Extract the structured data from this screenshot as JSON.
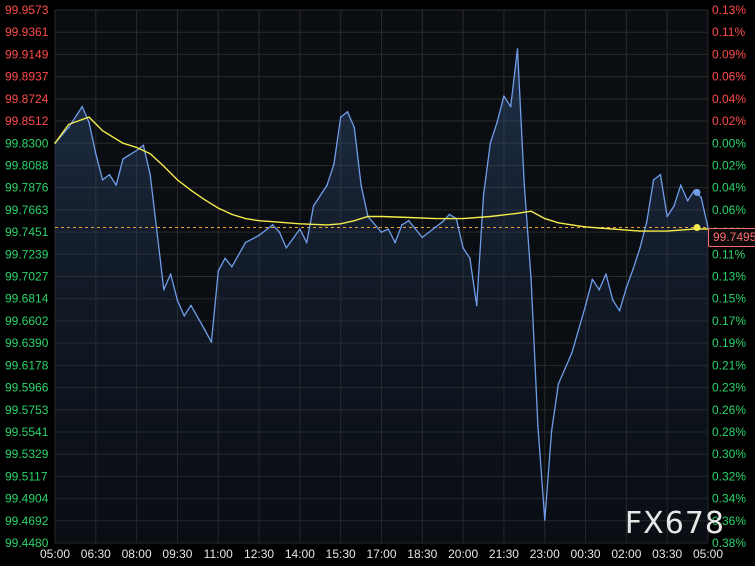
{
  "watermark": "FX678",
  "last_price_label": "99.7495",
  "colors": {
    "background": "#000000",
    "grid": "#2a2a2a",
    "price_line": "#6f9de8",
    "average_line": "#f4ec4a",
    "baseline": "#f2a232",
    "up_text": "#ff4b4b",
    "down_text": "#2bd46b",
    "x_text": "#e6e6e6"
  },
  "chart_data": {
    "type": "line",
    "title": "",
    "xlabel": "",
    "ylabel": "",
    "grid": true,
    "x_ticks": [
      "05:00",
      "06:30",
      "08:00",
      "09:30",
      "11:00",
      "12:30",
      "14:00",
      "15:30",
      "17:00",
      "18:30",
      "20:00",
      "21:30",
      "23:00",
      "00:30",
      "02:00",
      "03:30",
      "05:00"
    ],
    "y_ticks_left": [
      "99.9573",
      "99.9361",
      "99.9149",
      "99.8937",
      "99.8724",
      "99.8512",
      "99.8300",
      "99.8088",
      "99.7876",
      "99.7663",
      "99.7451",
      "99.7239",
      "99.7027",
      "99.6814",
      "99.6602",
      "99.6390",
      "99.6178",
      "99.5966",
      "99.5753",
      "99.5541",
      "99.5329",
      "99.5117",
      "99.4904",
      "99.4692",
      "99.4480"
    ],
    "y_ticks_right": [
      "0.13%",
      "0.11%",
      "0.09%",
      "0.06%",
      "0.04%",
      "0.02%",
      "0.00%",
      "0.02%",
      "0.04%",
      "0.06%",
      "0.09%",
      "0.11%",
      "0.13%",
      "0.15%",
      "0.17%",
      "0.19%",
      "0.21%",
      "0.23%",
      "0.26%",
      "0.28%",
      "0.30%",
      "0.32%",
      "0.34%",
      "0.36%",
      "0.38%"
    ],
    "ylim": [
      99.448,
      99.9573
    ],
    "baseline": 99.83,
    "last_value": 99.7495,
    "series": [
      {
        "role": "price",
        "x": [
          "05:00",
          "05:30",
          "06:00",
          "06:15",
          "06:30",
          "06:45",
          "07:00",
          "07:15",
          "07:30",
          "08:00",
          "08:15",
          "08:30",
          "09:00",
          "09:15",
          "09:30",
          "09:45",
          "10:00",
          "10:30",
          "10:45",
          "11:00",
          "11:15",
          "11:30",
          "12:00",
          "12:30",
          "13:00",
          "13:15",
          "13:30",
          "14:00",
          "14:15",
          "14:30",
          "15:00",
          "15:15",
          "15:30",
          "15:45",
          "16:00",
          "16:15",
          "16:30",
          "17:00",
          "17:15",
          "17:30",
          "17:45",
          "18:00",
          "18:30",
          "19:00",
          "19:15",
          "19:30",
          "19:45",
          "20:00",
          "20:15",
          "20:30",
          "20:45",
          "21:00",
          "21:15",
          "21:30",
          "21:45",
          "22:00",
          "22:15",
          "22:30",
          "22:45",
          "23:00",
          "23:15",
          "23:30",
          "23:45",
          "00:00",
          "00:30",
          "00:45",
          "01:00",
          "01:15",
          "01:30",
          "01:45",
          "02:00",
          "02:15",
          "02:30",
          "02:45",
          "03:00",
          "03:15",
          "03:30",
          "03:45",
          "04:00",
          "04:15",
          "04:30",
          "04:45",
          "05:00"
        ],
        "values": [
          99.83,
          99.845,
          99.865,
          99.85,
          99.82,
          99.795,
          99.8,
          99.79,
          99.815,
          99.823,
          99.828,
          99.8,
          99.69,
          99.705,
          99.68,
          99.665,
          99.675,
          99.652,
          99.64,
          99.708,
          99.72,
          99.712,
          99.735,
          99.742,
          99.752,
          99.745,
          99.73,
          99.748,
          99.735,
          99.77,
          99.79,
          99.81,
          99.855,
          99.86,
          99.845,
          99.79,
          99.76,
          99.745,
          99.748,
          99.735,
          99.752,
          99.756,
          99.74,
          99.75,
          99.755,
          99.762,
          99.758,
          99.73,
          99.72,
          99.675,
          99.78,
          99.83,
          99.85,
          99.875,
          99.865,
          99.92,
          99.79,
          99.7,
          99.56,
          99.47,
          99.555,
          99.6,
          99.615,
          99.63,
          99.675,
          99.7,
          99.69,
          99.705,
          99.68,
          99.67,
          99.692,
          99.71,
          99.73,
          99.755,
          99.795,
          99.8,
          99.76,
          99.77,
          99.79,
          99.775,
          99.785,
          99.778,
          99.7495
        ]
      },
      {
        "role": "average",
        "x": [
          "05:00",
          "05:30",
          "06:15",
          "06:45",
          "07:30",
          "08:00",
          "08:30",
          "09:00",
          "09:30",
          "10:00",
          "10:30",
          "11:00",
          "11:30",
          "12:00",
          "12:30",
          "13:00",
          "14:00",
          "15:00",
          "15:30",
          "16:00",
          "16:30",
          "17:00",
          "18:00",
          "19:00",
          "20:00",
          "21:00",
          "22:00",
          "22:30",
          "23:00",
          "23:30",
          "00:00",
          "00:30",
          "01:00",
          "01:30",
          "02:00",
          "02:30",
          "03:00",
          "03:30",
          "04:00",
          "04:30",
          "05:00"
        ],
        "values": [
          99.83,
          99.848,
          99.855,
          99.842,
          99.83,
          99.826,
          99.82,
          99.808,
          99.795,
          99.785,
          99.776,
          99.768,
          99.762,
          99.758,
          99.756,
          99.755,
          99.753,
          99.752,
          99.753,
          99.756,
          99.76,
          99.76,
          99.759,
          99.758,
          99.758,
          99.76,
          99.763,
          99.765,
          99.758,
          99.754,
          99.752,
          99.75,
          99.749,
          99.748,
          99.747,
          99.746,
          99.746,
          99.746,
          99.747,
          99.748,
          99.748
        ]
      }
    ]
  }
}
